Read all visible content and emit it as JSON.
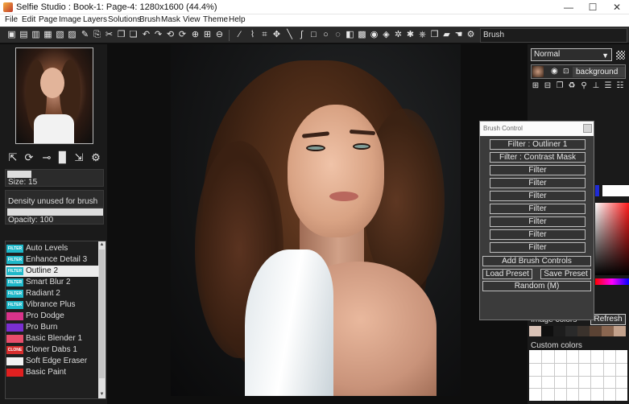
{
  "window": {
    "title": "Selfie Studio : Book-1: Page-4: 1280x1600  (44.4%)",
    "minimize": "—",
    "maximize": "☐",
    "close": "✕"
  },
  "menu": [
    "File",
    "Edit",
    "Page",
    "Image",
    "Layers",
    "Solutions",
    "Brush",
    "Mask",
    "View",
    "Theme",
    "Help"
  ],
  "toolbar": {
    "current_tool": "Brush"
  },
  "brush": {
    "size_label": "Size: 15",
    "size_fill": 0.25,
    "density_label": "Density unused for brush",
    "opacity_label": "Opacity: 100",
    "opacity_fill": 1.0
  },
  "filter_list": [
    {
      "label": "Auto Levels",
      "badge": "FILTER",
      "color": "#1fb8c9"
    },
    {
      "label": "Enhance Detail 3",
      "badge": "FILTER",
      "color": "#1fb8c9"
    },
    {
      "label": "Outline 2",
      "badge": "FILTER",
      "color": "#1fb8c9",
      "selected": true
    },
    {
      "label": "Smart Blur 2",
      "badge": "FILTER",
      "color": "#1fb8c9"
    },
    {
      "label": "Radiant 2",
      "badge": "FILTER",
      "color": "#1fb8c9"
    },
    {
      "label": "Vibrance Plus",
      "badge": "FILTER",
      "color": "#1fb8c9"
    },
    {
      "label": "Pro Dodge",
      "badge": "",
      "color": "#d9338a"
    },
    {
      "label": "Pro Burn",
      "badge": "",
      "color": "#7a2fd0"
    },
    {
      "label": "Basic Blender 1",
      "badge": "",
      "color": "#e84d6b"
    },
    {
      "label": "Cloner Dabs 1",
      "badge": "CLONE",
      "color": "#d62d2d"
    },
    {
      "label": "Soft Edge Eraser",
      "badge": "",
      "color": "#f2f2f2"
    },
    {
      "label": "Basic Paint",
      "badge": "",
      "color": "#e02020"
    }
  ],
  "brush_control": {
    "title": "Brush Control",
    "filters": [
      "Filter : Outliner 1",
      "Filter : Contrast Mask",
      "Filter",
      "Filter",
      "Filter",
      "Filter",
      "Filter",
      "Filter",
      "Filter"
    ],
    "add": "Add Brush Controls",
    "load": "Load Preset",
    "save": "Save Preset",
    "random": "Random (M)"
  },
  "layers": {
    "blend_mode": "Normal",
    "layer_name": "background"
  },
  "colors": {
    "primary": "#ff0000",
    "image_colors_label": "Image colors",
    "refresh": "Refresh",
    "custom_colors_label": "Custom colors",
    "palette": [
      "#d9c2b6",
      "#0f0f0f",
      "#1d1d1d",
      "#2a2a2a",
      "#3a322c",
      "#5b4334",
      "#8a6650",
      "#c3a28c"
    ]
  }
}
